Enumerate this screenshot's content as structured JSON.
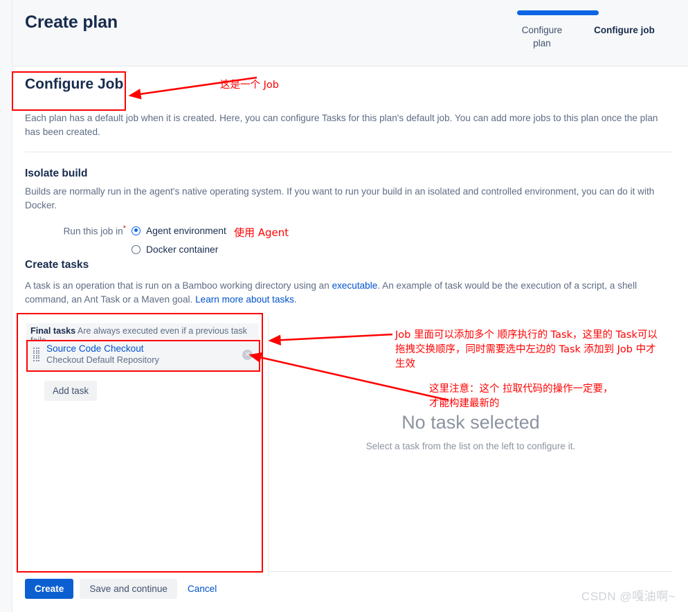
{
  "header": {
    "title": "Create plan",
    "wizard": {
      "steps": [
        {
          "label": "Configure plan",
          "state": "inactive"
        },
        {
          "label": "Configure job",
          "state": "active"
        }
      ],
      "progress_percent": 53,
      "accent_color": "#0c66e4"
    }
  },
  "main": {
    "configure_job": {
      "heading": "Configure Job",
      "description": "Each plan has a default job when it is created. Here, you can configure Tasks for this plan's default job. You can add more jobs to this plan once the plan has been created."
    },
    "isolate_build": {
      "heading": "Isolate build",
      "description": "Builds are normally run in the agent's native operating system. If you want to run your build in an isolated and controlled environment, you can do it with Docker.",
      "field_label": "Run this job in",
      "required_marker": "*",
      "options": [
        {
          "label": "Agent environment",
          "selected": true
        },
        {
          "label": "Docker container",
          "selected": false
        }
      ]
    },
    "create_tasks": {
      "heading": "Create tasks",
      "description_part1": "A task is an operation that is run on a Bamboo working directory using an ",
      "link1": "executable",
      "description_part2": ". An example of task would be the execution of a script, a shell command, an Ant Task or a Maven goal. ",
      "link2": "Learn more about tasks",
      "description_part3": "."
    },
    "task_list": {
      "section_header_strong": "Final tasks",
      "section_header_rest": "Are always executed even if a previous task fails",
      "tasks": [
        {
          "name": "Source Code Checkout",
          "subtitle": "Checkout Default Repository",
          "delete_icon": "close-circle-icon",
          "drag_icon": "drag-handle-icon"
        }
      ],
      "add_task_label": "Add task"
    },
    "task_detail": {
      "empty_title": "No task selected",
      "empty_subtitle": "Select a task from the list on the left to configure it."
    }
  },
  "footer": {
    "create_label": "Create",
    "save_continue_label": "Save and continue",
    "cancel_label": "Cancel"
  },
  "watermark": "CSDN @嘎油啊~",
  "annotations": {
    "color": "#ff0000",
    "notes": [
      {
        "id": "note-job",
        "text": "这是一个 Job"
      },
      {
        "id": "note-agent",
        "text": "使用 Agent"
      },
      {
        "id": "note-tasks",
        "text": "Job 里面可以添加多个 顺序执行的 Task，这里的 Task可以\n拖拽交换顺序，同时需要选中左边的 Task 添加到 Job 中才\n生效"
      },
      {
        "id": "note-checkout",
        "text": "这里注意：这个 拉取代码的操作一定要，\n才能构建最新的"
      }
    ]
  }
}
